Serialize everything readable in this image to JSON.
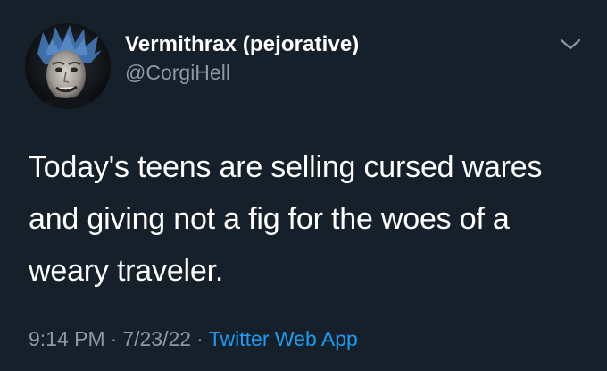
{
  "tweet": {
    "display_name": "Vermithrax (pejorative)",
    "handle": "@CorgiHell",
    "text": "Today's teens are selling cursed wares and giving not a fig for the woes of a weary traveler.",
    "time": "9:14 PM",
    "separator": "·",
    "date": "7/23/22",
    "source": "Twitter Web App"
  },
  "icons": {
    "menu": "chevron-down-icon",
    "avatar": "profile-photo"
  },
  "colors": {
    "background": "#15202b",
    "primary_text": "#ffffff",
    "secondary_text": "#8b98a5",
    "link": "#1d9bf0"
  }
}
